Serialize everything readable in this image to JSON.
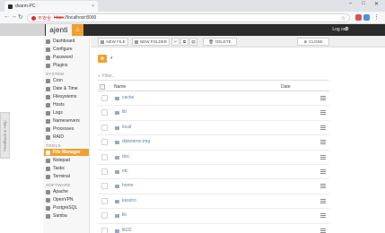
{
  "browser": {
    "tab_title": "dvarm-PC",
    "tab_close": "×",
    "security_text": "不安全",
    "url_scheme": "https",
    "url_rest": "://localhost:8000",
    "win_minimize": "–",
    "win_maximize": "□",
    "win_close": "✕"
  },
  "app": {
    "brand": "ajenti",
    "logout": "Log out",
    "accent": "#f0a030"
  },
  "sidebar": {
    "items": [
      {
        "label": "Dashboard"
      },
      {
        "label": "Configure"
      },
      {
        "label": "Password"
      },
      {
        "label": "Plugins"
      }
    ],
    "system_header": "SYSTEM",
    "system_items": [
      {
        "label": "Cron"
      },
      {
        "label": "Date & Time"
      },
      {
        "label": "Filesystems"
      },
      {
        "label": "Hosts"
      },
      {
        "label": "Logs"
      },
      {
        "label": "Nameservers"
      },
      {
        "label": "Processes"
      },
      {
        "label": "RAID"
      }
    ],
    "tools_header": "TOOLS",
    "tools_items": [
      {
        "label": "File Manager"
      },
      {
        "label": "Notepad"
      },
      {
        "label": "Tasks"
      },
      {
        "label": "Terminal"
      }
    ],
    "software_header": "SOFTWARE",
    "software_items": [
      {
        "label": "Apache"
      },
      {
        "label": "OpenVPN"
      },
      {
        "label": "PostgreSQL"
      },
      {
        "label": "Samba"
      }
    ],
    "feedback": "Feedback & Help"
  },
  "toolbar": {
    "new_file": "NEW FILE",
    "new_folder": "NEW FOLDER",
    "delete": "DELETE",
    "close": "CLOSE"
  },
  "filemanager": {
    "filter_placeholder": "Filter...",
    "col_name": "Name",
    "col_date": "Date",
    "files": [
      {
        "name": "cache"
      },
      {
        "name": "lib"
      },
      {
        "name": "local"
      },
      {
        "name": "diskmirror.img"
      },
      {
        "name": "doc"
      },
      {
        "name": "etc"
      },
      {
        "name": "home"
      },
      {
        "name": "kasicro"
      },
      {
        "name": "lib"
      },
      {
        "name": "lib32"
      }
    ]
  }
}
